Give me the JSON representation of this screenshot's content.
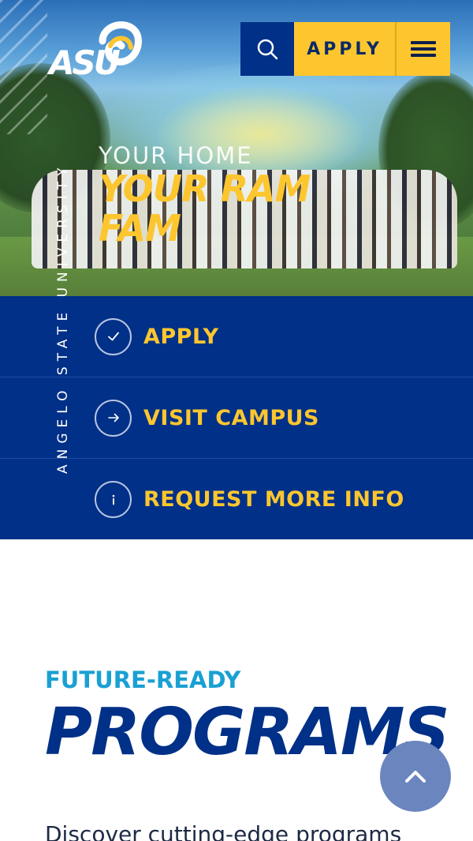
{
  "header": {
    "logo_text": "ASU",
    "apply_label": "APPLY",
    "icons": {
      "search": "search-icon",
      "menu": "hamburger-menu-icon"
    }
  },
  "hero": {
    "line1": "YOUR HOME",
    "line2": "YOUR RAM FAM",
    "vertical_label": "ANGELO STATE UNIVERSITY"
  },
  "cta": {
    "items": [
      {
        "label": "APPLY",
        "icon": "check-icon"
      },
      {
        "label": "VISIT CAMPUS",
        "icon": "arrow-right-icon"
      },
      {
        "label": "REQUEST MORE INFO",
        "icon": "info-icon"
      }
    ]
  },
  "programs": {
    "eyebrow": "FUTURE-READY",
    "title": "PROGRAMS",
    "description": "Discover cutting-edge programs"
  },
  "colors": {
    "navy": "#003087",
    "gold": "#fdc62f",
    "cyan": "#1aa0d3",
    "scroll_button": "#6b86bf"
  }
}
